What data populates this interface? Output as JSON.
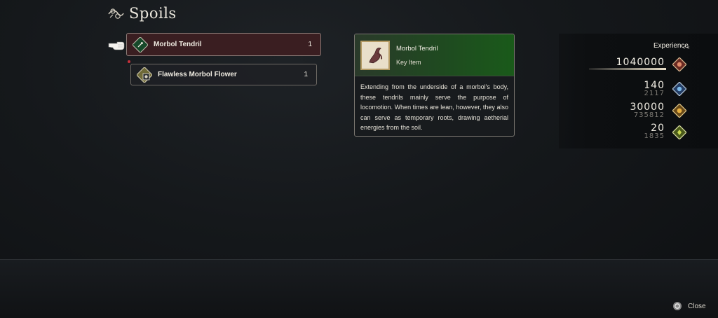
{
  "screen": {
    "title": "Spoils"
  },
  "items": [
    {
      "name": "Morbol Tendril",
      "quantity": "1",
      "selected": true,
      "icon": "tendril-icon"
    },
    {
      "name": "Flawless Morbol Flower",
      "quantity": "1",
      "selected": false,
      "icon": "flower-icon"
    }
  ],
  "detail": {
    "name": "Morbol Tendril",
    "category": "Key Item",
    "description": "Extending from the underside of a morbol's body, these tendrils mainly serve the purpose of locomotion. When times are lean, however, they also can serve as temporary roots, drawing aetherial energies from the soil."
  },
  "rewards": {
    "label": "Experience",
    "experience": "1040000",
    "stat1": {
      "gain": "140",
      "total": "2117"
    },
    "stat2": {
      "gain": "30000",
      "total": "735812"
    },
    "stat3": {
      "gain": "20",
      "total": "1835"
    }
  },
  "footer": {
    "close_label": "Close"
  },
  "colors": {
    "selected_row": "#3a1e21",
    "detail_header": "#1f4a20",
    "new_marker": "#c8303a"
  }
}
